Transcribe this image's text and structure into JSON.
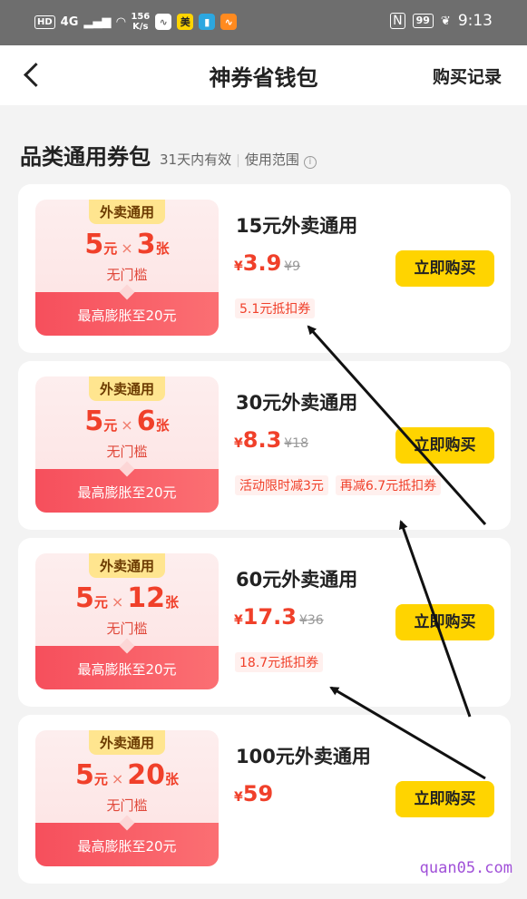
{
  "status_bar": {
    "network": "HD",
    "signal": "4G",
    "speed": "156\nK/s",
    "app1": "美",
    "battery": "99",
    "time": "9:13"
  },
  "nav": {
    "title": "神券省钱包",
    "record": "购买记录"
  },
  "section": {
    "title": "品类通用券包",
    "valid": "31天内有效",
    "sep": "|",
    "scope": "使用范围",
    "info": "i"
  },
  "cards": [
    {
      "coupon_tag": "外卖通用",
      "amount": "5",
      "unit": "元",
      "times": "×",
      "count": "3",
      "count_unit": "张",
      "threshold": "无门槛",
      "bottom": "最高膨胀至20元",
      "title": "15元外卖通用",
      "yen": "¥",
      "price": "3.9",
      "original": "¥9",
      "tags": [
        "5.1元抵扣券"
      ],
      "buy": "立即购买"
    },
    {
      "coupon_tag": "外卖通用",
      "amount": "5",
      "unit": "元",
      "times": "×",
      "count": "6",
      "count_unit": "张",
      "threshold": "无门槛",
      "bottom": "最高膨胀至20元",
      "title": "30元外卖通用",
      "yen": "¥",
      "price": "8.3",
      "original": "¥18",
      "tags": [
        "活动限时减3元",
        "再减6.7元抵扣券"
      ],
      "buy": "立即购买"
    },
    {
      "coupon_tag": "外卖通用",
      "amount": "5",
      "unit": "元",
      "times": "×",
      "count": "12",
      "count_unit": "张",
      "threshold": "无门槛",
      "bottom": "最高膨胀至20元",
      "title": "60元外卖通用",
      "yen": "¥",
      "price": "17.3",
      "original": "¥36",
      "tags": [
        "18.7元抵扣券"
      ],
      "buy": "立即购买"
    },
    {
      "coupon_tag": "外卖通用",
      "amount": "5",
      "unit": "元",
      "times": "×",
      "count": "20",
      "count_unit": "张",
      "threshold": "无门槛",
      "bottom": "最高膨胀至20元",
      "title": "100元外卖通用",
      "yen": "¥",
      "price": "59",
      "original": "",
      "tags": [],
      "buy": "立即购买"
    }
  ],
  "watermark": "quan05.com",
  "colors": {
    "accent_red": "#f0402a",
    "buy_yellow": "#ffd400",
    "tag_gold": "#ffe58f"
  }
}
